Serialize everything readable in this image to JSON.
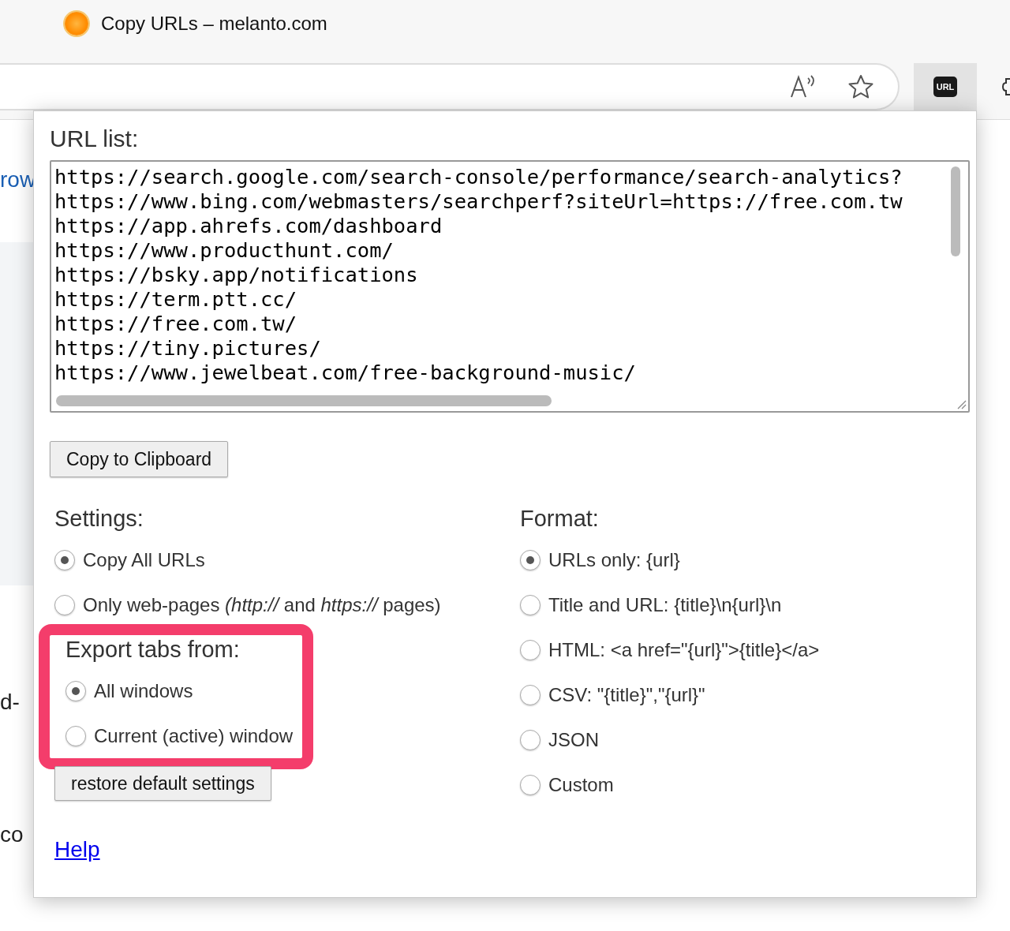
{
  "browser": {
    "tab_title": "Copy URLs – melanto.com",
    "extension_label": "URL"
  },
  "background_page": {
    "fragments": [
      {
        "text": "row",
        "kind": "link"
      },
      {
        "text": "d-",
        "kind": "text"
      },
      {
        "text": "co",
        "kind": "text"
      }
    ]
  },
  "popup": {
    "url_list_label": "URL list:",
    "urls": [
      "https://search.google.com/search-console/performance/search-analytics?",
      "https://www.bing.com/webmasters/searchperf?siteUrl=https://free.com.tw",
      "https://app.ahrefs.com/dashboard",
      "https://www.producthunt.com/",
      "https://bsky.app/notifications",
      "https://term.ptt.cc/",
      "https://free.com.tw/",
      "https://tiny.pictures/",
      "https://www.jewelbeat.com/free-background-music/"
    ],
    "copy_button": "Copy to Clipboard",
    "settings": {
      "title": "Settings:",
      "options": [
        {
          "label": "Copy All URLs",
          "selected": true
        },
        {
          "label": "Only web-pages *(http://* and *https://* pages)",
          "selected": false
        }
      ]
    },
    "export": {
      "title": "Export tabs from:",
      "highlighted": true,
      "options": [
        {
          "label": "All windows",
          "selected": true
        },
        {
          "label": "Current (active) window",
          "selected": false
        }
      ]
    },
    "restore_button": "restore default settings",
    "format": {
      "title": "Format:",
      "options": [
        {
          "label": "URLs only: {url}",
          "selected": true
        },
        {
          "label": "Title and URL: {title}\\n{url}\\n",
          "selected": false
        },
        {
          "label": "HTML: <a href=\"{url}\">{title}</a>",
          "selected": false
        },
        {
          "label": "CSV: \"{title}\",\"{url}\"",
          "selected": false
        },
        {
          "label": "JSON",
          "selected": false
        },
        {
          "label": "Custom",
          "selected": false
        }
      ]
    },
    "help_link": "Help"
  }
}
